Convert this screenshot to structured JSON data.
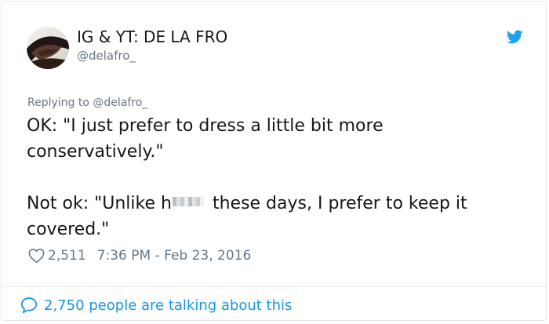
{
  "tweet": {
    "display_name": "IG & YT: DE LA FRO",
    "handle": "@delafro_",
    "replying_to": "Replying to @delafro_",
    "line1": "OK: \"I just prefer to dress a little bit more",
    "line2": "conservatively.\"",
    "line3_before": "Not ok: \"Unlike h",
    "line3_after": " these days, I prefer to keep it",
    "line4": "covered.\"",
    "likes": "2,511",
    "timestamp": "7:36 PM - Feb 23, 2016"
  },
  "footer": {
    "talking_label": "2,750 people are talking about this"
  },
  "icons": {
    "brand": "twitter-bird-icon",
    "like": "heart-icon",
    "conversation": "speech-bubble-icon"
  },
  "colors": {
    "twitter_blue": "#1da1f2",
    "link_blue": "#1b95e0",
    "secondary_text": "#657786",
    "primary_text": "#14171a"
  }
}
